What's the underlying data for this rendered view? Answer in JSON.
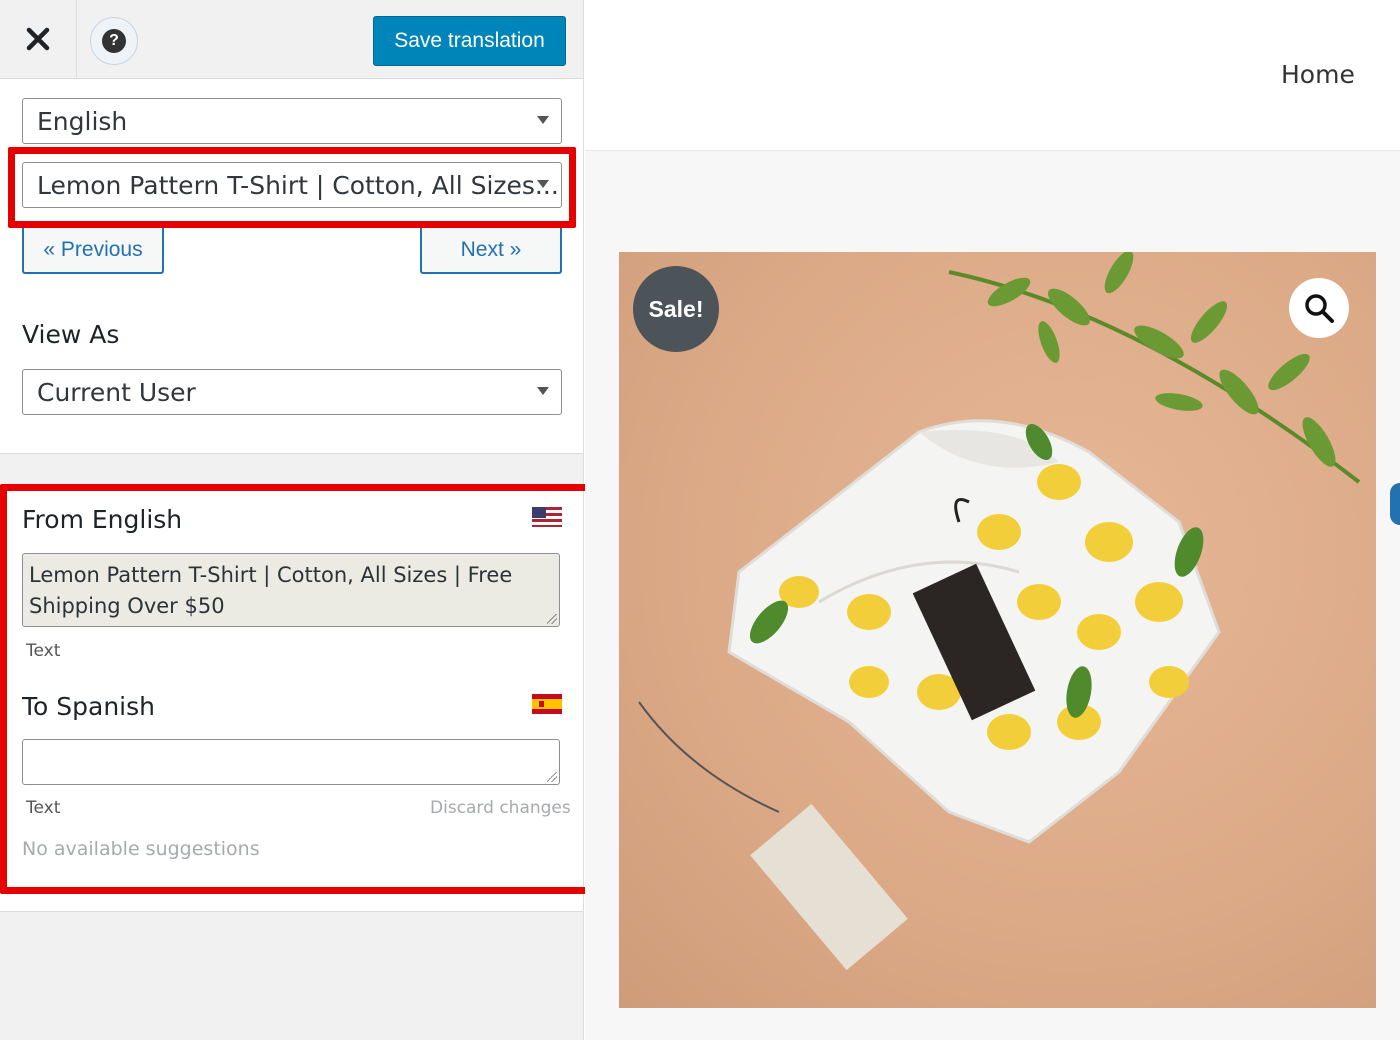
{
  "toolbar": {
    "save_label": "Save translation",
    "help_glyph": "?"
  },
  "language_select": {
    "value": "English"
  },
  "string_select": {
    "value": "Lemon Pattern T-Shirt | Cotton, All Sizes..."
  },
  "nav": {
    "previous": "« Previous",
    "next": "Next »"
  },
  "view_as": {
    "label": "View As",
    "value": "Current User"
  },
  "from": {
    "heading": "From English",
    "text": "Lemon Pattern T-Shirt | Cotton, All Sizes | Free Shipping Over $50",
    "type_label": "Text",
    "flag_icon": "us-flag-icon"
  },
  "to": {
    "heading": "To Spanish",
    "value": "",
    "type_label": "Text",
    "discard": "Discard changes",
    "suggestions": "No available suggestions",
    "flag_icon": "spain-flag-icon"
  },
  "preview": {
    "menu_home": "Home",
    "sale_badge": "Sale!",
    "product_image": "lemon-pattern-tshirt-photo"
  },
  "colors": {
    "accent": "#0085ba",
    "highlight": "#e60000",
    "sale_badge": "#4c5359"
  }
}
